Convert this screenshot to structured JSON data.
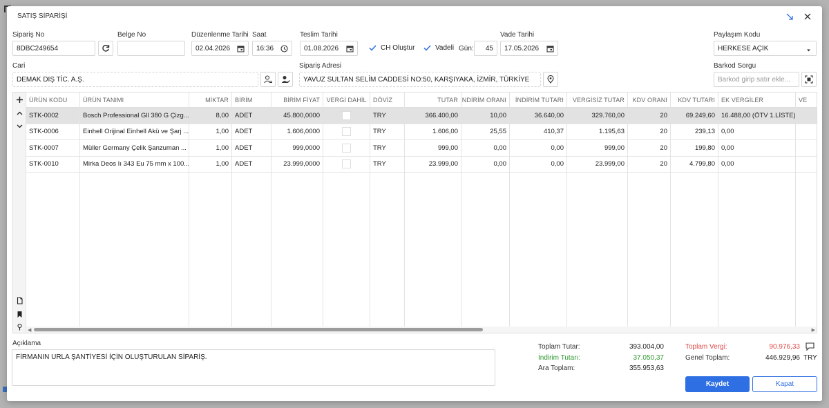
{
  "dialog": {
    "title": "SATIŞ SİPARİŞİ"
  },
  "form": {
    "order_no_label": "Sipariş No",
    "order_no": "8DBC249654",
    "doc_no_label": "Belge No",
    "doc_no": "",
    "edit_date_label": "Düzenlenme Tarihi",
    "edit_date": "02.04.2026",
    "time_label": "Saat",
    "time": "16:36",
    "delivery_date_label": "Teslim Tarihi",
    "delivery_date": "01.08.2026",
    "ch_label": "CH Oluştur",
    "ch_checked": true,
    "term_label": "Vadeli",
    "term_checked": true,
    "days_label": "Gün:",
    "days": "45",
    "due_date_label": "Vade Tarihi",
    "due_date": "17.05.2026",
    "share_label": "Paylaşım Kodu",
    "share_value": "HERKESE AÇIK",
    "account_label": "Cari",
    "account": "DEMAK DIŞ TİC. A.Ş.",
    "address_label": "Sipariş Adresi",
    "address": "YAVUZ SULTAN SELİM CADDESİ NO:50, KARŞIYAKA, İZMİR, TÜRKİYE",
    "barcode_label": "Barkod Sorgu",
    "barcode_placeholder": "Barkod girip satır ekle..."
  },
  "table": {
    "headers": [
      "ÜRÜN KODU",
      "ÜRÜN TANIMI",
      "MİKTAR",
      "BİRİM",
      "BİRİM FİYAT",
      "VERGİ DAHİL",
      "DÖVİZ",
      "TUTAR",
      "İNDİRİM ORANI",
      "İNDİRİM TUTARI",
      "VERGİSİZ TUTAR",
      "KDV ORANI",
      "KDV TUTARI",
      "EK VERGİLER",
      "VE"
    ],
    "rows": [
      [
        "STK-0002",
        "Bosch Professional Gll 380 G Çizg...",
        "8,00",
        "ADET",
        "45.800,0000",
        "",
        "TRY",
        "366.400,00",
        "10,00",
        "36.640,00",
        "329.760,00",
        "20",
        "69.249,60",
        "16.488,00 (ÖTV 1.LİSTE)",
        ""
      ],
      [
        "STK-0006",
        "Einhell Orijinal Einhell Akü ve Şarj ...",
        "1,00",
        "ADET",
        "1.606,0000",
        "",
        "TRY",
        "1.606,00",
        "25,55",
        "410,37",
        "1.195,63",
        "20",
        "239,13",
        "0,00",
        ""
      ],
      [
        "STK-0007",
        "Müller Germany Çelik Şanzuman ...",
        "1,00",
        "ADET",
        "999,0000",
        "",
        "TRY",
        "999,00",
        "0,00",
        "0,00",
        "999,00",
        "20",
        "199,80",
        "0,00",
        ""
      ],
      [
        "STK-0010",
        "Mirka Deos Iı 343 Eu 75 mm x 100...",
        "1,00",
        "ADET",
        "23.999,0000",
        "",
        "TRY",
        "23.999,00",
        "0,00",
        "0,00",
        "23.999,00",
        "20",
        "4.799,80",
        "0,00",
        ""
      ]
    ]
  },
  "notes": {
    "label": "Açıklama",
    "text": "FİRMANIN URLA ŞANTİYESİ İÇİN OLUŞTURULAN SİPARİŞ."
  },
  "totals": {
    "total_label": "Toplam Tutar:",
    "total": "393.004,00",
    "discount_label": "İndirim Tutarı:",
    "discount": "37.050,37",
    "subtotal_label": "Ara Toplam:",
    "subtotal": "355.953,63",
    "tax_label": "Toplam Vergi:",
    "tax": "90.976,33",
    "grand_label": "Genel Toplam:",
    "grand": "446.929,96",
    "currency": "TRY"
  },
  "buttons": {
    "save": "Kaydet",
    "close": "Kapat"
  },
  "colors": {
    "primary": "#2e6fe3",
    "green": "#2e9a2e",
    "red": "#e04a4a"
  }
}
